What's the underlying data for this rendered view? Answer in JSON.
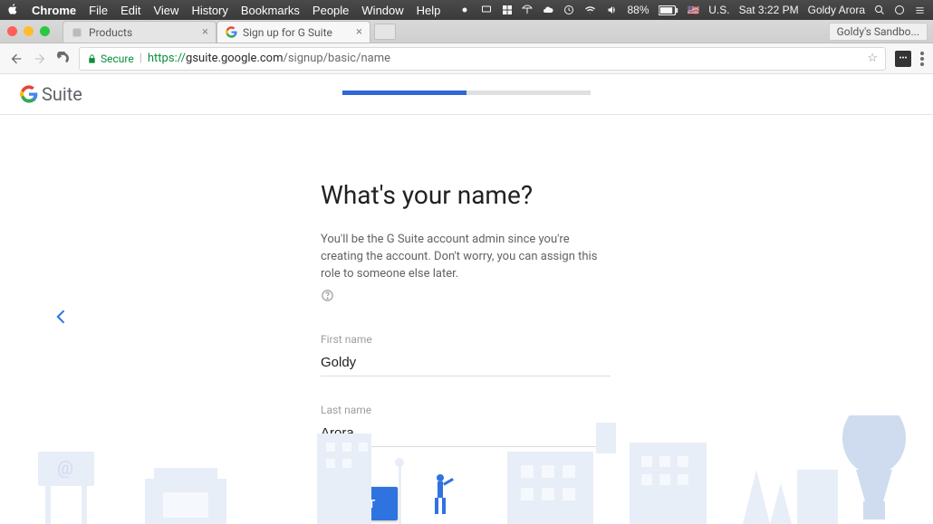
{
  "menubar": {
    "app": "Chrome",
    "items": [
      "File",
      "Edit",
      "View",
      "History",
      "Bookmarks",
      "People",
      "Window",
      "Help"
    ],
    "battery_pct": "88%",
    "locale_flag": "U.S.",
    "clock": "Sat 3:22 PM",
    "user": "Goldy Arora"
  },
  "chrome": {
    "tabs": [
      {
        "title": "Products",
        "active": false,
        "favicon": "generic"
      },
      {
        "title": "Sign up for G Suite",
        "active": true,
        "favicon": "google"
      }
    ],
    "profile_chip": "Goldy's Sandbo...",
    "secure_label": "Secure",
    "url_proto": "https://",
    "url_host": "gsuite.google.com",
    "url_path": "/signup/basic/name"
  },
  "page": {
    "brand": "Suite",
    "progress_pct": 50,
    "title": "What's your name?",
    "help": "You'll be the G Suite account admin since you're creating the account. Don't worry, you can assign this role to someone else later.",
    "first_name_label": "First name",
    "first_name_value": "Goldy",
    "last_name_label": "Last name",
    "last_name_value": "Arora",
    "next_label": "NEXT"
  }
}
